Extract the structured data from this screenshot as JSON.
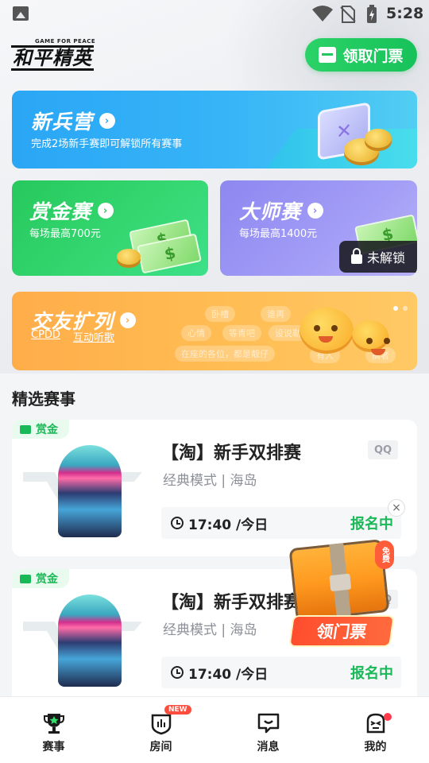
{
  "status_bar": {
    "time": "5:28"
  },
  "header": {
    "logo_small": "GAME FOR PEACE",
    "logo_main": "和平精英",
    "ticket_button": "领取门票"
  },
  "cards": {
    "recruit": {
      "title": "新兵营",
      "subtitle": "完成2场新手赛即可解锁所有赛事"
    },
    "bounty": {
      "title": "赏金赛",
      "subtitle": "每场最高700元"
    },
    "master": {
      "title": "大师赛",
      "subtitle": "每场最高1400元",
      "locked_label": "未解锁"
    },
    "social": {
      "title": "交友扩列",
      "links": [
        "CPDD",
        "互动听歌"
      ],
      "bubbles": [
        "卧槽",
        "谁再",
        "心情",
        "等青吧",
        "设说勒",
        "在座的各位，都是靓仔",
        "有人",
        "搞者"
      ]
    }
  },
  "section": {
    "title": "精选赛事"
  },
  "matches": [
    {
      "badge": "赏金",
      "title": "【淘】新手双排赛",
      "platform": "QQ",
      "mode": "经典模式 | 海岛",
      "time": "17:40 /今日",
      "status": "报名中"
    },
    {
      "badge": "赏金",
      "title": "【淘】新手双排赛",
      "platform": "QQ",
      "mode": "经典模式 | 海岛",
      "time": "17:40 /今日",
      "status": "报名中"
    }
  ],
  "promo": {
    "free_tag": "免费",
    "label": "领门票",
    "close": "×"
  },
  "tabs": [
    {
      "label": "赛事",
      "icon": "trophy-icon",
      "active": true
    },
    {
      "label": "房间",
      "icon": "room-icon",
      "badge": "NEW"
    },
    {
      "label": "消息",
      "icon": "message-icon"
    },
    {
      "label": "我的",
      "icon": "profile-icon",
      "dot": true
    }
  ],
  "colors": {
    "green": "#19b957",
    "blue": "#2aa6f5",
    "purple": "#8d87f0",
    "orange": "#ffad4a"
  }
}
